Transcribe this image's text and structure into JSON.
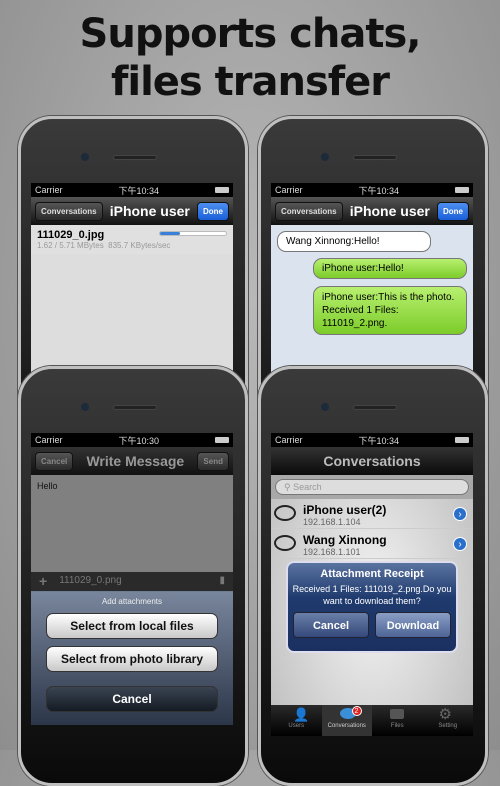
{
  "headline": [
    "Supports chats,",
    "files transfer"
  ],
  "status": {
    "carrier": "Carrier",
    "time_a": "下午10:34",
    "time_b": "下午10:30"
  },
  "p1": {
    "back": "Conversations",
    "title": "iPhone user",
    "done": "Done",
    "file": "111029_0.jpg",
    "progress": 0.3,
    "size": "1.62 / 5.71 MBytes",
    "speed": "835.7 KBytes/sec"
  },
  "p2": {
    "back": "Conversations",
    "title": "iPhone user",
    "done": "Done",
    "messages": [
      "Wang Xinnong:Hello!",
      "iPhone user:Hello!",
      "iPhone user:This is the photo.\nReceived 1 Files:\n111019_2.png."
    ]
  },
  "p3": {
    "cancel": "Cancel",
    "title": "Write Message",
    "send": "Send",
    "body": "Hello",
    "attachment": "111029_0.png",
    "sheet_title": "Add attachments",
    "opt1": "Select from local files",
    "opt2": "Select from photo library",
    "opt3": "Cancel"
  },
  "p4": {
    "title": "Conversations",
    "search": "Search",
    "rows": [
      {
        "name": "iPhone user(2)",
        "ip": "192.168.1.104"
      },
      {
        "name": "Wang Xinnong",
        "ip": "192.168.1.101"
      }
    ],
    "alert_title": "Attachment Receipt",
    "alert_msg": "Received 1 Files: 111019_2.png.Do you want to download them?",
    "alert_cancel": "Cancel",
    "alert_ok": "Download",
    "tabs": [
      "Users",
      "Conversations",
      "Files",
      "Setting"
    ],
    "badge": "2"
  }
}
